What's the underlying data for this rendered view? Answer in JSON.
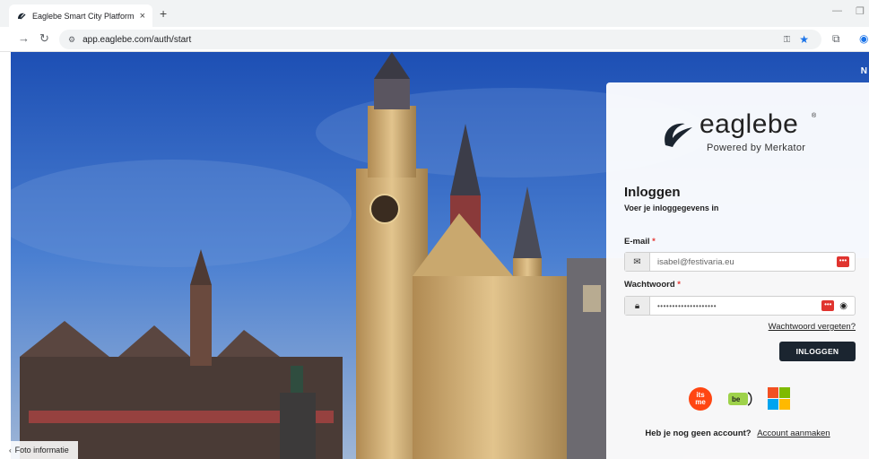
{
  "browser": {
    "tab_title": "Eaglebe Smart City Platform",
    "tab_close": "×",
    "new_tab": "+",
    "url": "app.eaglebe.com/auth/start"
  },
  "page": {
    "corner_letter": "N",
    "photo_info": "Foto informatie"
  },
  "login": {
    "brand": "eaglebe",
    "brand_reg": "®",
    "powered_by": "Powered by Merkator",
    "title": "Inloggen",
    "subtitle": "Voer je inloggegevens in",
    "email_label": "E-mail",
    "email_value": "isabel@festivaria.eu",
    "password_label": "Wachtwoord",
    "password_value": "••••••••••••••••••••",
    "required_mark": "*",
    "forgot_link": "Wachtwoord vergeten?",
    "login_button": "INLOGGEN",
    "no_account_text": "Heb je nog geen account?",
    "create_account_link": "Account aanmaken"
  },
  "sso": {
    "itsme_line1": "its",
    "itsme_line2": "me",
    "beid_label": "be"
  },
  "colors": {
    "button": "#1b2530",
    "required": "#e53935",
    "sky": "#3a6fc7"
  }
}
